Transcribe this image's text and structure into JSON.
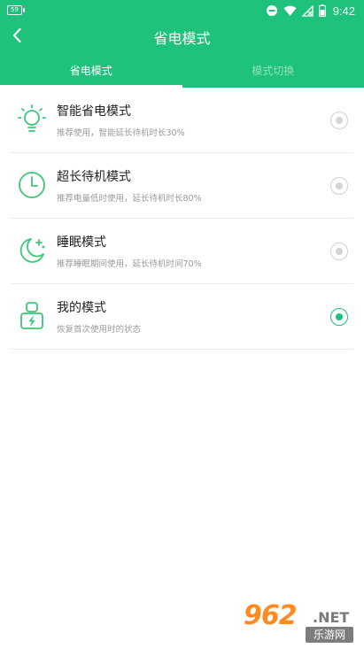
{
  "statusbar": {
    "battery_badge": "59",
    "time": "9:42"
  },
  "titlebar": {
    "title": "省电模式"
  },
  "tabs": [
    {
      "label": "省电模式",
      "active": true
    },
    {
      "label": "模式切换",
      "active": false
    }
  ],
  "modes": [
    {
      "title": "智能省电模式",
      "subtitle": "推荐使用，智能延长待机时长30%",
      "icon": "lightbulb-icon",
      "selected": false
    },
    {
      "title": "超长待机模式",
      "subtitle": "推荐电量低时使用，延长待机时长80%",
      "icon": "clock-icon",
      "selected": false
    },
    {
      "title": "睡眠模式",
      "subtitle": "推荐睡眠期间使用，延长待机时间70%",
      "icon": "moon-icon",
      "selected": false
    },
    {
      "title": "我的模式",
      "subtitle": "恢复首次使用时的状态",
      "icon": "user-battery-icon",
      "selected": true
    }
  ],
  "watermark": {
    "number": "962",
    "suffix": ".NET",
    "site_name": "乐游网"
  },
  "colors": {
    "accent": "#1ec27a",
    "icon_green": "#3cc77a",
    "radio_off": "#d4d4d4"
  }
}
